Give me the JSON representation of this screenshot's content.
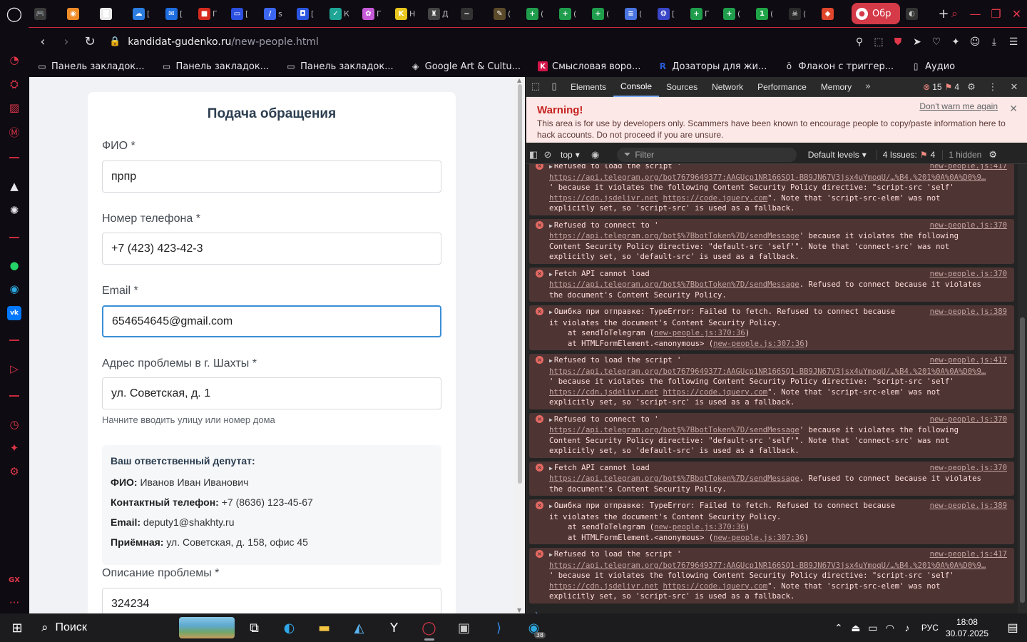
{
  "browser": {
    "active_tab_title": "Обр",
    "url_domain": "kandidat-gudenko.ru",
    "url_path": "/new-people.html",
    "mini_tabs": [
      {
        "icon": "gamepad-icon",
        "glyph": "🎮",
        "color": "#3a3a3a",
        "label": ""
      },
      {
        "icon": "orange-app-icon",
        "glyph": "◉",
        "color": "#f08c28",
        "label": ""
      },
      {
        "icon": "document-icon",
        "glyph": "▇",
        "color": "#eaeaea",
        "label": ""
      },
      {
        "icon": "cloud-icon",
        "glyph": "☁",
        "color": "#2b7de0",
        "label": "["
      },
      {
        "icon": "mail-icon",
        "glyph": "✉",
        "color": "#1e6ee0",
        "label": "["
      },
      {
        "icon": "russia-flag-icon",
        "glyph": "■",
        "color": "#d52b1e",
        "label": "Г"
      },
      {
        "icon": "folder-icon",
        "glyph": "▭",
        "color": "#2b4fe0",
        "label": "["
      },
      {
        "icon": "m-app-icon",
        "glyph": "/",
        "color": "#3b66f0",
        "label": "s"
      },
      {
        "icon": "chat-icon",
        "glyph": "◘",
        "color": "#2b56e0",
        "label": "["
      },
      {
        "icon": "check-icon",
        "glyph": "✓",
        "color": "#1fa595",
        "label": "К"
      },
      {
        "icon": "puzzle-icon",
        "glyph": "✿",
        "color": "#c65bd8",
        "label": "Г"
      },
      {
        "icon": "k-app-icon",
        "glyph": "K",
        "color": "#e8c61e",
        "label": "Н"
      },
      {
        "icon": "emblem-icon",
        "glyph": "♜",
        "color": "#444444",
        "label": "Д"
      },
      {
        "icon": "link-icon",
        "glyph": "~",
        "color": "#333333",
        "label": ""
      },
      {
        "icon": "tool-icon",
        "glyph": "✎",
        "color": "#5a4a2a",
        "label": "("
      },
      {
        "icon": "green-plus-icon",
        "glyph": "+",
        "color": "#1f9d4d",
        "label": "("
      },
      {
        "icon": "green-plus-icon",
        "glyph": "+",
        "color": "#1f9d4d",
        "label": "("
      },
      {
        "icon": "green-plus-icon",
        "glyph": "+",
        "color": "#1f9d4d",
        "label": "("
      },
      {
        "icon": "forms-icon",
        "glyph": "≡",
        "color": "#4a74e0",
        "label": "("
      },
      {
        "icon": "viber-icon",
        "glyph": "❂",
        "color": "#3a46c8",
        "label": "["
      },
      {
        "icon": "green-plus-icon",
        "glyph": "+",
        "color": "#1f9d4d",
        "label": "Г"
      },
      {
        "icon": "green-plus-icon",
        "glyph": "+",
        "color": "#1f9d4d",
        "label": "("
      },
      {
        "icon": "whatsapp-icon",
        "glyph": "1",
        "color": "#1fa347",
        "label": "("
      },
      {
        "icon": "skull-icon",
        "glyph": "☠",
        "color": "#2a2a2a",
        "label": "("
      },
      {
        "icon": "figma-icon",
        "glyph": "◆",
        "color": "#e0462c",
        "label": ""
      }
    ]
  },
  "bookmarks": [
    {
      "icon": "folder-icon",
      "glyph": "▭",
      "label": "Панель закладок..."
    },
    {
      "icon": "folder-icon",
      "glyph": "▭",
      "label": "Панель закладок..."
    },
    {
      "icon": "folder-icon",
      "glyph": "▭",
      "label": "Панель закладок..."
    },
    {
      "icon": "google-arts-icon",
      "glyph": "◈",
      "label": "Google Art & Cultu..."
    },
    {
      "icon": "k-app-icon",
      "glyph": "K",
      "label": "Смысловая воро..."
    },
    {
      "icon": "r-app-icon",
      "glyph": "R",
      "label": "Дозаторы для жи..."
    },
    {
      "icon": "ozon-icon",
      "glyph": "ō",
      "label": "Флакон с триггер..."
    },
    {
      "icon": "document-icon",
      "glyph": "▯",
      "label": "Аудио"
    }
  ],
  "form": {
    "title": "Подача обращения",
    "fio_label": "ФИО *",
    "fio_value": "прпр",
    "phone_label": "Номер телефона *",
    "phone_value": "+7 (423) 423-42-3",
    "email_label": "Email *",
    "email_value": "654654645@gmail.com",
    "address_label": "Адрес проблемы в г. Шахты *",
    "address_value": "ул. Советская, д. 1",
    "address_hint": "Начните вводить улицу или номер дома",
    "description_label": "Описание проблемы *",
    "description_value": "324234"
  },
  "deputy": {
    "title": "Ваш ответственный депутат:",
    "fio_key": "ФИО:",
    "fio_val": " Иванов Иван Иванович",
    "phone_key": "Контактный телефон:",
    "phone_val": " +7 (8636) 123-45-67",
    "email_key": "Email:",
    "email_val": " deputy1@shakhty.ru",
    "office_key": "Приёмная:",
    "office_val": " ул. Советская, д. 158, офис 45"
  },
  "devtools": {
    "tabs": [
      "Elements",
      "Console",
      "Sources",
      "Network",
      "Performance",
      "Memory"
    ],
    "active_tab": "Console",
    "error_count": "15",
    "warning_count": "4",
    "warning_title": "Warning!",
    "warning_body": "This area is for use by developers only. Scammers have been known to encourage people to copy/paste information here to hack accounts. Do not proceed if you are unsure.",
    "dont_warn": "Don't warn me again",
    "context": "top",
    "filter_placeholder": "Filter",
    "levels": "Default levels",
    "issues_label": "4 Issues:",
    "issues_count": "4",
    "hidden": "1 hidden"
  },
  "console_messages": [
    {
      "head": "Refused to load the script '",
      "src": "new-people.js:417",
      "lines": [
        {
          "link": "https://api.telegram.org/bot7679649377:AAGUcp1NR166SQ1-BB9JN67V3jsx4uYmoqU/…%B4.%201%0A%0A%D0%9…",
          "text": ""
        },
        {
          "link": "",
          "text": "' because it violates the following Content Security Policy directive: \"script-src 'self'"
        },
        {
          "link": "https://cdn.jsdelivr.net",
          "link2": "https://code.jquery.com",
          "text": "\". Note that 'script-src-elem' was not"
        },
        {
          "link": "",
          "text": "explicitly set, so 'script-src' is used as a fallback."
        }
      ]
    },
    {
      "head": "Refused to connect to '",
      "src": "new-people.js:370",
      "lines": [
        {
          "link": "https://api.telegram.org/bot$%7BbotToken%7D/sendMessage",
          "text": "' because it violates the following"
        },
        {
          "link": "",
          "text": "Content Security Policy directive: \"default-src 'self'\". Note that 'connect-src' was not"
        },
        {
          "link": "",
          "text": "explicitly set, so 'default-src' is used as a fallback."
        }
      ]
    },
    {
      "head": "Fetch API cannot load",
      "src": "new-people.js:370",
      "lines": [
        {
          "link": "https://api.telegram.org/bot$%7BbotToken%7D/sendMessage",
          "text": ". Refused to connect because it violates"
        },
        {
          "link": "",
          "text": "the document's Content Security Policy."
        }
      ]
    },
    {
      "head": "Ошибка при отправке: TypeError: Failed to fetch. Refused to connect because",
      "src": "new-people.js:389",
      "lines": [
        {
          "link": "",
          "text": "it violates the document's Content Security Policy."
        },
        {
          "indent": true,
          "pre": "at sendToTelegram (",
          "link": "new-people.js:370:36",
          "text": ")"
        },
        {
          "indent": true,
          "pre": "at HTMLFormElement.<anonymous> (",
          "link": "new-people.js:307:36",
          "text": ")"
        }
      ]
    },
    {
      "head": "Refused to load the script '",
      "src": "new-people.js:417",
      "lines": [
        {
          "link": "https://api.telegram.org/bot7679649377:AAGUcp1NR166SQ1-BB9JN67V3jsx4uYmoqU/…%B4.%201%0A%0A%D0%9…",
          "text": ""
        },
        {
          "link": "",
          "text": "' because it violates the following Content Security Policy directive: \"script-src 'self'"
        },
        {
          "link": "https://cdn.jsdelivr.net",
          "link2": "https://code.jquery.com",
          "text": "\". Note that 'script-src-elem' was not"
        },
        {
          "link": "",
          "text": "explicitly set, so 'script-src' is used as a fallback."
        }
      ]
    },
    {
      "head": "Refused to connect to '",
      "src": "new-people.js:370",
      "lines": [
        {
          "link": "https://api.telegram.org/bot$%7BbotToken%7D/sendMessage",
          "text": "' because it violates the following"
        },
        {
          "link": "",
          "text": "Content Security Policy directive: \"default-src 'self'\". Note that 'connect-src' was not"
        },
        {
          "link": "",
          "text": "explicitly set, so 'default-src' is used as a fallback."
        }
      ]
    },
    {
      "head": "Fetch API cannot load",
      "src": "new-people.js:370",
      "lines": [
        {
          "link": "https://api.telegram.org/bot$%7BbotToken%7D/sendMessage",
          "text": ". Refused to connect because it violates"
        },
        {
          "link": "",
          "text": "the document's Content Security Policy."
        }
      ]
    },
    {
      "head": "Ошибка при отправке: TypeError: Failed to fetch. Refused to connect because",
      "src": "new-people.js:389",
      "lines": [
        {
          "link": "",
          "text": "it violates the document's Content Security Policy."
        },
        {
          "indent": true,
          "pre": "at sendToTelegram (",
          "link": "new-people.js:370:36",
          "text": ")"
        },
        {
          "indent": true,
          "pre": "at HTMLFormElement.<anonymous> (",
          "link": "new-people.js:307:36",
          "text": ")"
        }
      ]
    },
    {
      "head": "Refused to load the script '",
      "src": "new-people.js:417",
      "lines": [
        {
          "link": "https://api.telegram.org/bot7679649377:AAGUcp1NR166SQ1-BB9JN67V3jsx4uYmoqU/…%B4.%201%0A%0A%D0%9…",
          "text": ""
        },
        {
          "link": "",
          "text": "' because it violates the following Content Security Policy directive: \"script-src 'self'"
        },
        {
          "link": "https://cdn.jsdelivr.net",
          "link2": "https://code.jquery.com",
          "text": "\". Note that 'script-src-elem' was not"
        },
        {
          "link": "",
          "text": "explicitly set, so 'script-src' is used as a fallback."
        }
      ]
    }
  ],
  "taskbar": {
    "search_label": "Поиск",
    "language": "РУС",
    "time": "18:08",
    "date": "30.07.2025",
    "telegram_badge": "38"
  },
  "colors": {
    "accent_red": "#e0374a",
    "focus_blue": "#3a8fd6",
    "console_error_bg": "#4e3534"
  }
}
